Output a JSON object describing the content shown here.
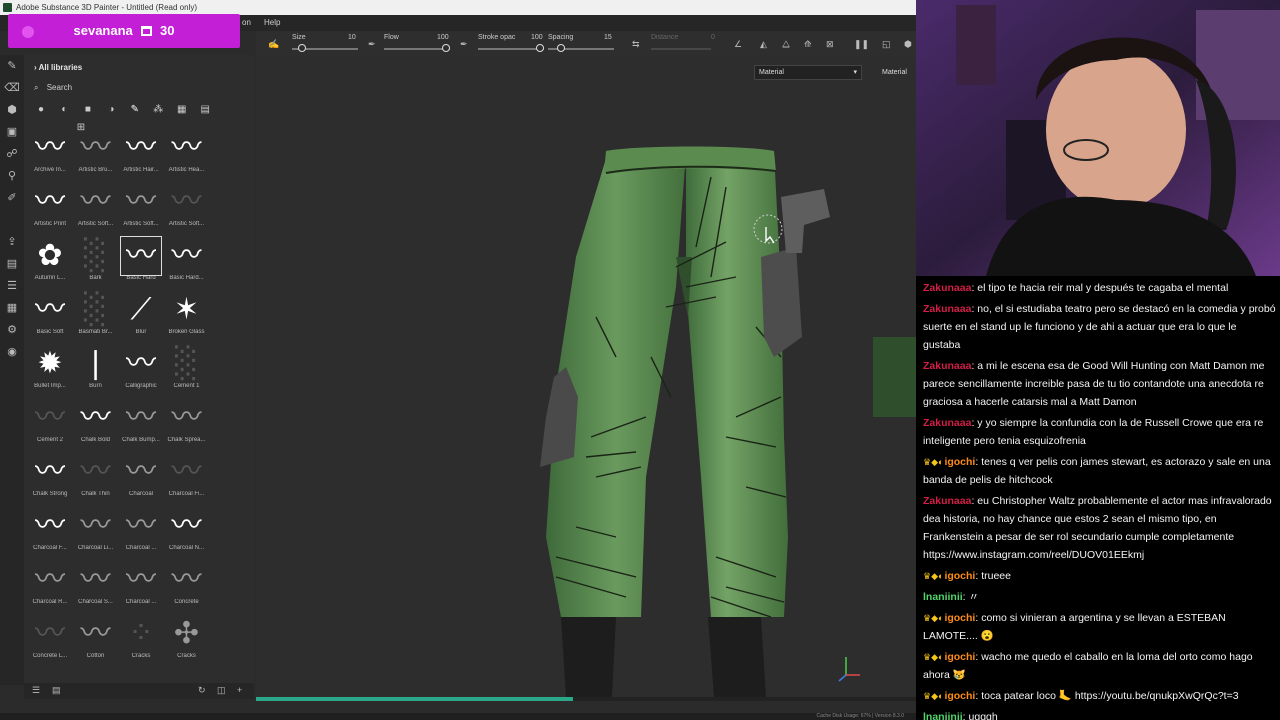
{
  "window": {
    "title": "Adobe Substance 3D Painter - Untitled (Read only)"
  },
  "menu": {
    "items": [
      "on",
      "Help"
    ]
  },
  "stream_badge": {
    "user": "sevanana",
    "count": "30"
  },
  "toolbar": {
    "size": {
      "label": "Size",
      "value": "10",
      "level": 0.1
    },
    "flow": {
      "label": "Flow",
      "value": "100",
      "level": 1.0
    },
    "stroke_opacity": {
      "label": "Stroke opac",
      "value": "100",
      "level": 1.0
    },
    "spacing": {
      "label": "Spacing",
      "value": "15",
      "level": 0.15
    },
    "distance": {
      "label": "Distance",
      "value": "0"
    }
  },
  "viewport": {
    "material_dropdown": "Material",
    "material_label": "Material",
    "progress": 0.48
  },
  "shelf": {
    "header": "All libraries",
    "search_placeholder": "Search",
    "brushes": [
      {
        "label": "Archive In...",
        "glyph": "〰",
        "style": ""
      },
      {
        "label": "Artistic Bru...",
        "glyph": "〰",
        "style": "dim"
      },
      {
        "label": "Artistic Hair...",
        "glyph": "〰",
        "style": ""
      },
      {
        "label": "Artistic Hea...",
        "glyph": "〰",
        "style": ""
      },
      {
        "label": "Artistic Print",
        "glyph": "〰",
        "style": ""
      },
      {
        "label": "Artistic Soft...",
        "glyph": "〰",
        "style": "dim"
      },
      {
        "label": "Artistic Soft...",
        "glyph": "〰",
        "style": "dim"
      },
      {
        "label": "Artistic Soft...",
        "glyph": "〰",
        "style": "faint"
      },
      {
        "label": "Autumn L...",
        "glyph": "✿",
        "style": ""
      },
      {
        "label": "Bark",
        "glyph": "░",
        "style": "faint"
      },
      {
        "label": "Basic Hard",
        "glyph": "〰",
        "style": "",
        "selected": true
      },
      {
        "label": "Basic Hard...",
        "glyph": "〰",
        "style": ""
      },
      {
        "label": "Basic Soft",
        "glyph": "〰",
        "style": ""
      },
      {
        "label": "Basmati Br...",
        "glyph": "░",
        "style": "faint"
      },
      {
        "label": "Blur",
        "glyph": "⟋",
        "style": ""
      },
      {
        "label": "Broken Glass",
        "glyph": "✶",
        "style": ""
      },
      {
        "label": "Bullet Imp...",
        "glyph": "✹",
        "style": ""
      },
      {
        "label": "Burn",
        "glyph": "❘",
        "style": ""
      },
      {
        "label": "Calligraphic",
        "glyph": "〰",
        "style": ""
      },
      {
        "label": "Cement 1",
        "glyph": "░",
        "style": "faint"
      },
      {
        "label": "Cement 2",
        "glyph": "〰",
        "style": "faint"
      },
      {
        "label": "Chalk Bold",
        "glyph": "〰",
        "style": ""
      },
      {
        "label": "Chalk Bump...",
        "glyph": "〰",
        "style": "dim"
      },
      {
        "label": "Chalk Sprea...",
        "glyph": "〰",
        "style": "dim"
      },
      {
        "label": "Chalk Strong",
        "glyph": "〰",
        "style": ""
      },
      {
        "label": "Chalk Thin",
        "glyph": "〰",
        "style": "faint"
      },
      {
        "label": "Charcoal",
        "glyph": "〰",
        "style": "dim"
      },
      {
        "label": "Charcoal Fi...",
        "glyph": "〰",
        "style": "faint"
      },
      {
        "label": "Charcoal F...",
        "glyph": "〰",
        "style": ""
      },
      {
        "label": "Charcoal Li...",
        "glyph": "〰",
        "style": "dim"
      },
      {
        "label": "Charcoal ...",
        "glyph": "〰",
        "style": "dim"
      },
      {
        "label": "Charcoal N...",
        "glyph": "〰",
        "style": ""
      },
      {
        "label": "Charcoal R...",
        "glyph": "〰",
        "style": "dim"
      },
      {
        "label": "Charcoal S...",
        "glyph": "〰",
        "style": "dim"
      },
      {
        "label": "Charcoal ...",
        "glyph": "〰",
        "style": "dim"
      },
      {
        "label": "Concrete",
        "glyph": "〰",
        "style": "dim"
      },
      {
        "label": "Concrete L...",
        "glyph": "〰",
        "style": "faint"
      },
      {
        "label": "Cotton",
        "glyph": "〰",
        "style": "dim"
      },
      {
        "label": "Cracks",
        "glyph": "⁘",
        "style": "faint"
      },
      {
        "label": "Cracks",
        "glyph": "✣",
        "style": "dim"
      }
    ]
  },
  "status": {
    "text": "Cache Disk Usage: 67% | Version 8.3.0"
  },
  "chat": {
    "user_color_z": "#d11f45",
    "user_color_g": "#ff8c1a",
    "user_color_i": "#52d46b",
    "messages": [
      {
        "user": "Zakunaaa",
        "color": "#d11f45",
        "badges": "",
        "text": "el tipo te hacia reir mal y después te cagaba el mental"
      },
      {
        "user": "Zakunaaa",
        "color": "#d11f45",
        "badges": "",
        "text": "no, el si estudiaba teatro pero se destacó en la comedia y probó suerte en el stand up le funciono y de ahi a actuar que era lo que le gustaba"
      },
      {
        "user": "Zakunaaa",
        "color": "#d11f45",
        "badges": "",
        "text": "a mi le escena esa de Good Will Hunting con Matt Damon me parece sencillamente increible pasa de tu tio contandote una anecdota re graciosa a hacerle catarsis mal a Matt Damon"
      },
      {
        "user": "Zakunaaa",
        "color": "#d11f45",
        "badges": "",
        "text": "y yo siempre la confundia con la de Russell Crowe que era re inteligente pero tenia esquizofrenia"
      },
      {
        "user": "igochi",
        "color": "#ff8c1a",
        "badges": "♛◆◐",
        "text": "tenes q ver pelis con james stewart, es actorazo y sale en una banda de pelis de hitchcock"
      },
      {
        "user": "Zakunaaa",
        "color": "#d11f45",
        "badges": "",
        "text": "eu Christopher Waltz probablemente el actor mas infravalorado dea historia, no hay chance que estos 2 sean el mismo tipo, en Frankenstein a pesar de ser rol secundario cumple completamente https://www.instagram.com/reel/DUOV01EEkmj"
      },
      {
        "user": "igochi",
        "color": "#ff8c1a",
        "badges": "♛◆◐",
        "text": "trueee"
      },
      {
        "user": "lnaniinii",
        "color": "#52d46b",
        "badges": "",
        "text": "〃"
      },
      {
        "user": "igochi",
        "color": "#ff8c1a",
        "badges": "♛◆◐",
        "text": "como si vinieran a argentina y se llevan a ESTEBAN LAMOTE.... 😮"
      },
      {
        "user": "igochi",
        "color": "#ff8c1a",
        "badges": "♛◆◐",
        "text": "wacho me quedo el caballo en la loma del orto como hago ahora 😿"
      },
      {
        "user": "igochi",
        "color": "#ff8c1a",
        "badges": "♛◆◐",
        "text": "toca patear loco 🦶 https://youtu.be/qnukpXwQrQc?t=3"
      },
      {
        "user": "lnaniinii",
        "color": "#52d46b",
        "badges": "",
        "text": "ugggh"
      }
    ]
  }
}
